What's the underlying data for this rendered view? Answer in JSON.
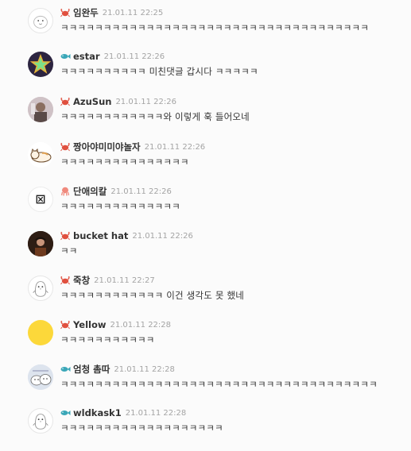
{
  "comments": [
    {
      "author": "임완두",
      "time": "21.01.11 22:25",
      "text": "ㅋㅋㅋㅋㅋㅋㅋㅋㅋㅋㅋㅋㅋㅋㅋㅋㅋㅋㅋㅋㅋㅋㅋㅋㅋㅋㅋㅋㅋㅋㅋㅋㅋㅋㅋㅋ",
      "avatar": "seal-avatar",
      "badge": "crab-icon"
    },
    {
      "author": "estar",
      "time": "21.01.11 22:26",
      "text": "ㅋㅋㅋㅋㅋㅋㅋㅋㅋㅋ 미친댓글 갑시다 ㅋㅋㅋㅋㅋ",
      "avatar": "star-avatar",
      "badge": "fish-icon"
    },
    {
      "author": "AzuSun",
      "time": "21.01.11 22:26",
      "text": "ㅋㅋㅋㅋㅋㅋㅋㅋㅋㅋㅋㅋ와 이렇게 훅 들어오네",
      "avatar": "photo-avatar",
      "badge": "crab-icon"
    },
    {
      "author": "짱아야미미야놀자",
      "time": "21.01.11 22:26",
      "text": "ㅋㅋㅋㅋㅋㅋㅋㅋㅋㅋㅋㅋㅋㅋㅋ",
      "avatar": "cat-avatar",
      "badge": "crab-icon"
    },
    {
      "author": "단애의칼",
      "time": "21.01.11 22:26",
      "text": "ㅋㅋㅋㅋㅋㅋㅋㅋㅋㅋㅋㅋㅋㅋ",
      "avatar": "broken-image-avatar",
      "badge": "octopus-icon"
    },
    {
      "author": "bucket hat",
      "time": "21.01.11 22:26",
      "text": "ㅋㅋ",
      "avatar": "person-avatar",
      "badge": "crab-icon"
    },
    {
      "author": "죽창",
      "time": "21.01.11 22:27",
      "text": "ㅋㅋㅋㅋㅋㅋㅋㅋㅋㅋㅋㅋ 이건 생각도 못 했네",
      "avatar": "penguin-avatar",
      "badge": "crab-icon"
    },
    {
      "author": "Yellow",
      "time": "21.01.11 22:28",
      "text": "ㅋㅋㅋㅋㅋㅋㅋㅋㅋㅋㅋ",
      "avatar": "yellow-circle-avatar",
      "badge": "crab-icon",
      "avatar_color": "#fcd83a"
    },
    {
      "author": "엄청 촘따",
      "time": "21.01.11 22:28",
      "text": "ㅋㅋㅋㅋㅋㅋㅋㅋㅋㅋㅋㅋㅋㅋㅋㅋㅋㅋㅋㅋㅋㅋㅋㅋㅋㅋㅋㅋㅋㅋㅋㅋㅋㅋㅋㅋㅋ",
      "avatar": "doodle-avatar",
      "badge": "fish-icon"
    },
    {
      "author": "wldkask1",
      "time": "21.01.11 22:28",
      "text": "ㅋㅋㅋㅋㅋㅋㅋㅋㅋㅋㅋㅋㅋㅋㅋㅋㅋㅋㅋ",
      "avatar": "penguin-avatar",
      "badge": "fish-icon"
    }
  ],
  "colors": {
    "crab": "#e0503f",
    "fish": "#3aa7b8",
    "octopus": "#f08a7d",
    "author": "#333333",
    "time": "#a4a4a4"
  }
}
